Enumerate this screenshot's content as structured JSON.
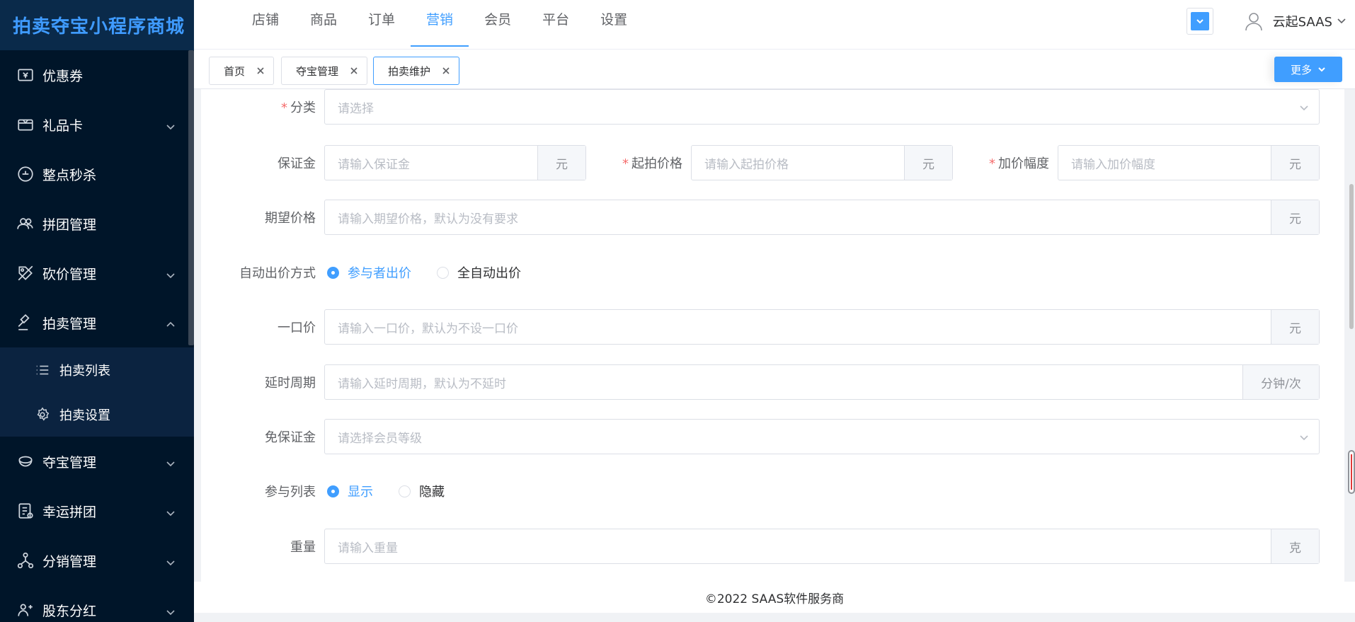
{
  "sidebar": {
    "title": "拍卖夺宝小程序商城",
    "items": [
      {
        "label": "优惠券",
        "icon": "coupon-icon",
        "has_arrow": false
      },
      {
        "label": "礼品卡",
        "icon": "gift-card-icon",
        "has_arrow": true
      },
      {
        "label": "整点秒杀",
        "icon": "flash-sale-icon",
        "has_arrow": false
      },
      {
        "label": "拼团管理",
        "icon": "group-buy-icon",
        "has_arrow": false
      },
      {
        "label": "砍价管理",
        "icon": "bargain-icon",
        "has_arrow": true
      },
      {
        "label": "拍卖管理",
        "icon": "auction-icon",
        "has_arrow": true,
        "expanded": true
      },
      {
        "label": "夺宝管理",
        "icon": "treasure-icon",
        "has_arrow": true
      },
      {
        "label": "幸运拼团",
        "icon": "lucky-group-icon",
        "has_arrow": true
      },
      {
        "label": "分销管理",
        "icon": "distribution-icon",
        "has_arrow": true
      },
      {
        "label": "股东分红",
        "icon": "dividend-icon",
        "has_arrow": true
      }
    ],
    "subitems": [
      {
        "label": "拍卖列表",
        "icon": "list-icon"
      },
      {
        "label": "拍卖设置",
        "icon": "gear-icon"
      }
    ]
  },
  "topnav": {
    "items": [
      "店铺",
      "商品",
      "订单",
      "营销",
      "会员",
      "平台",
      "设置"
    ],
    "active": "营销"
  },
  "user": {
    "name": "云起SAAS"
  },
  "tabs": [
    {
      "label": "首页",
      "active": false
    },
    {
      "label": "夺宝管理",
      "active": false
    },
    {
      "label": "拍卖维护",
      "active": true
    }
  ],
  "more_label": "更多",
  "form": {
    "category": {
      "label": "分类",
      "placeholder": "请选择"
    },
    "deposit": {
      "label": "保证金",
      "placeholder": "请输入保证金",
      "suffix": "元"
    },
    "start_price": {
      "label": "起拍价格",
      "placeholder": "请输入起拍价格",
      "suffix": "元"
    },
    "increment": {
      "label": "加价幅度",
      "placeholder": "请输入加价幅度",
      "suffix": "元"
    },
    "expected_price": {
      "label": "期望价格",
      "placeholder": "请输入期望价格，默认为没有要求",
      "suffix": "元"
    },
    "auto_bid": {
      "label": "自动出价方式",
      "options": [
        "参与者出价",
        "全自动出价"
      ],
      "selected": "参与者出价"
    },
    "buyout_price": {
      "label": "一口价",
      "placeholder": "请输入一口价，默认为不设一口价",
      "suffix": "元"
    },
    "delay": {
      "label": "延时周期",
      "placeholder": "请输入延时周期，默认为不延时",
      "suffix": "分钟/次"
    },
    "free_deposit": {
      "label": "免保证金",
      "placeholder": "请选择会员等级"
    },
    "participant_list": {
      "label": "参与列表",
      "options": [
        "显示",
        "隐藏"
      ],
      "selected": "显示"
    },
    "weight": {
      "label": "重量",
      "placeholder": "请输入重量",
      "suffix": "克"
    }
  },
  "footer": {
    "text": "©2022 SAAS软件服务商"
  },
  "colors": {
    "primary": "#409eff",
    "sidebar_bg": "#001529",
    "required": "#f56c6c"
  }
}
